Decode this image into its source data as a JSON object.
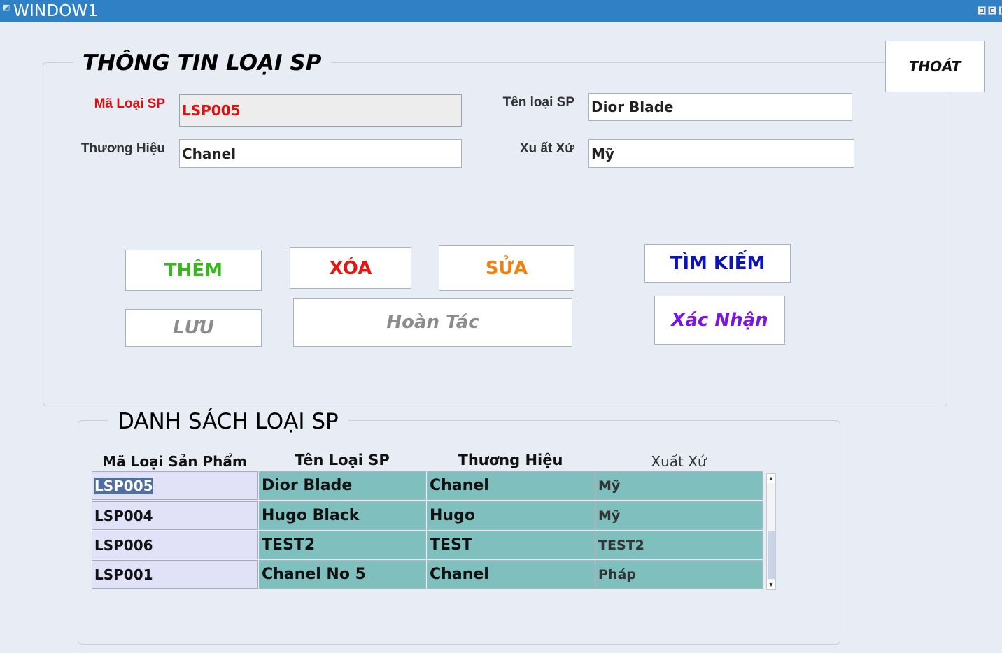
{
  "window": {
    "title": "WINDOW1"
  },
  "info_group": {
    "title": "THÔNG TIN LOẠI SP",
    "labels": {
      "ma_loai": "Mã Loại SP",
      "ten_loai": "Tên loại SP",
      "thuong_hieu": "Thương Hiệu",
      "xuat_xu": "Xu ất Xứ"
    },
    "values": {
      "ma_loai": "LSP005",
      "ten_loai": "Dior Blade",
      "thuong_hieu": "Chanel",
      "xuat_xu": "Mỹ"
    }
  },
  "buttons": {
    "thoat": "THOÁT",
    "them": "THÊM",
    "xoa": "XÓA",
    "sua": "SỬA",
    "tim_kiem": "TÌM KIẾM",
    "luu": "LƯU",
    "hoan_tac": "Hoàn Tác",
    "xac_nhan": "Xác Nhận"
  },
  "colors": {
    "them": "#3cb522",
    "xoa": "#e81414",
    "sua": "#f08010",
    "tim_kiem": "#0a14b8",
    "disabled": "#8c8c8c",
    "xac_nhan": "#7a16e0",
    "thoat": "#111111",
    "title_bar": "#2f80c4",
    "table_teal": "#7fbfbd",
    "table_key": "#e1e1f8"
  },
  "list_group": {
    "title": "DANH SÁCH LOẠI SP",
    "columns": [
      "Mã Loại Sản Phẩm",
      "Tên Loại SP",
      "Thương Hiệu",
      "Xuất Xứ"
    ],
    "rows": [
      [
        "LSP005",
        "Dior Blade",
        "Chanel",
        "Mỹ"
      ],
      [
        "LSP004",
        "Hugo Black",
        "Hugo",
        "Mỹ"
      ],
      [
        "LSP006",
        "TEST2",
        "TEST",
        "TEST2"
      ],
      [
        "LSP001",
        "Chanel No 5",
        "Chanel",
        "Pháp"
      ]
    ]
  }
}
